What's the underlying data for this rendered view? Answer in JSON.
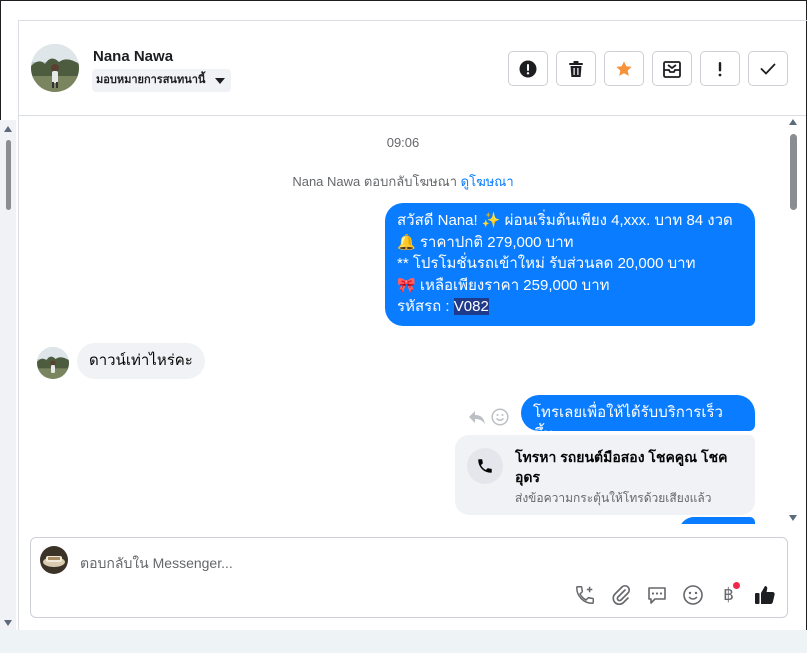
{
  "contact": {
    "name": "Nana Nawa",
    "assign_label": "มอบหมายการสนทนานี้"
  },
  "header_actions": [
    {
      "name": "spam-button",
      "icon": "exclamation-circle-icon"
    },
    {
      "name": "delete-button",
      "icon": "trash-icon"
    },
    {
      "name": "star-button",
      "icon": "star-icon"
    },
    {
      "name": "archive-button",
      "icon": "archive-icon"
    },
    {
      "name": "mark-important-button",
      "icon": "exclamation-icon"
    },
    {
      "name": "mark-done-button",
      "icon": "check-icon"
    }
  ],
  "thread": {
    "timestamp": "09:06",
    "reply_context": "Nana Nawa ตอบกลับโฆษณา",
    "reply_context_link": "ดูโฆษณา",
    "promo_message": {
      "line1": "สวัสดี Nana! ✨  ผ่อนเริ่มต้นเพียง 4,xxx. บาท 84 งวด",
      "line2": "🔔 ราคาปกติ 279,000 บาท",
      "line3": "** โปรโมชั่นรถเข้าใหม่ รับส่วนลด 20,000 บาท",
      "line4": "🎀  เหลือเพียงราคา 259,000 บาท",
      "line5_prefix": " รหัสรถ : ",
      "line5_code": "V082"
    },
    "incoming_message": "ดาวน์เท่าไหร่คะ",
    "outgoing_message": "โทรเลยเพื่อให้ได้รับบริการเร็วขึ้น",
    "call_card": {
      "title": "โทรหา รถยนต์มือสอง โชคคูณ โชค อุดร",
      "subtitle": "ส่งข้อความกระตุ้นให้โทรด้วยเสียงแล้ว"
    }
  },
  "composer": {
    "placeholder": "ตอบกลับใน Messenger...",
    "tools": [
      "call-plus-icon",
      "paperclip-icon",
      "saved-reply-icon",
      "emoji-icon",
      "baht-icon",
      "like-icon"
    ],
    "baht_symbol": "฿"
  },
  "colors": {
    "accent": "#0a7cff",
    "star": "#f7923a",
    "notification_dot": "#f02849"
  }
}
